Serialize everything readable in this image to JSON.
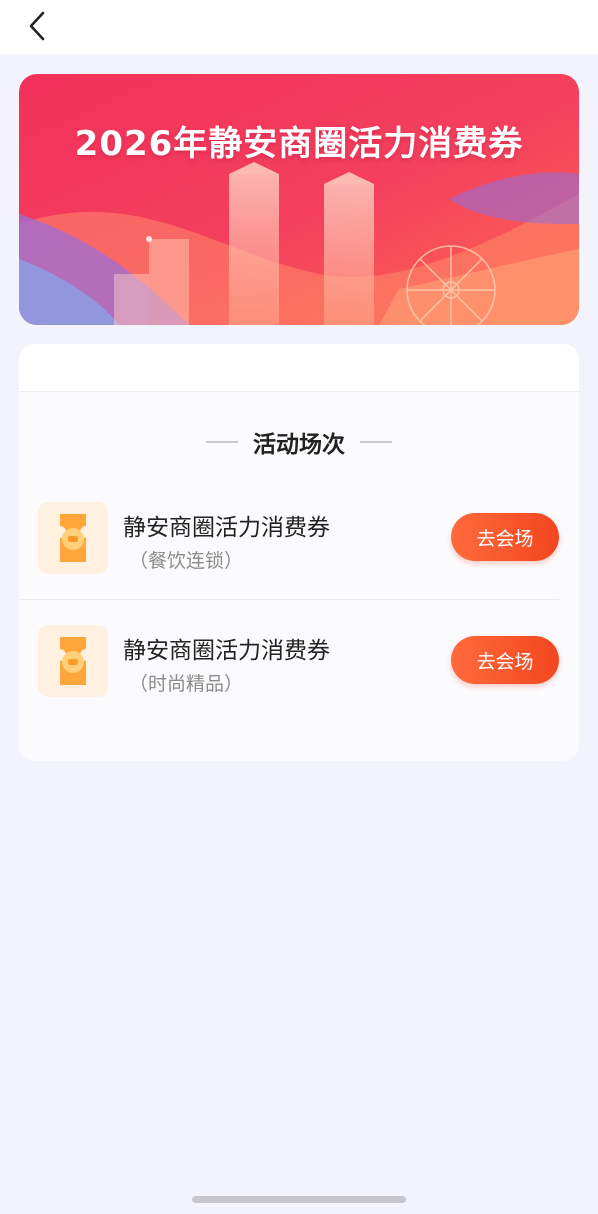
{
  "nav": {
    "back_icon": "chevron-left-icon"
  },
  "banner": {
    "title": "2026年静安商圈活力消费券",
    "colors": {
      "primary": "#f2315a",
      "secondary": "#ff7a4a"
    }
  },
  "section": {
    "title": "活动场次"
  },
  "sessions": [
    {
      "name": "静安商圈活力消费券",
      "sub": "（餐饮连锁）",
      "action_label": "去会场",
      "icon": "coupon-ticket-icon"
    },
    {
      "name": "静安商圈活力消费券",
      "sub": "（时尚精品）",
      "action_label": "去会场",
      "icon": "coupon-ticket-icon"
    }
  ],
  "theme": {
    "accent": "#f2461f",
    "background": "#f3f4fb"
  }
}
